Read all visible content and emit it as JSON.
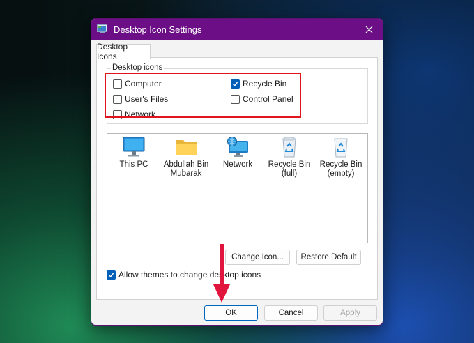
{
  "window": {
    "title": "Desktop Icon Settings",
    "accent_color": "#6c0e86"
  },
  "tabs": [
    {
      "label": "Desktop Icons",
      "active": true
    }
  ],
  "desktop_icons_group": {
    "legend": "Desktop icons",
    "items": [
      {
        "label": "Computer",
        "checked": false
      },
      {
        "label": "Recycle Bin",
        "checked": true
      },
      {
        "label": "User's Files",
        "checked": false
      },
      {
        "label": "Control Panel",
        "checked": false
      },
      {
        "label": "Network",
        "checked": false
      }
    ]
  },
  "icon_list": [
    {
      "label": "This PC",
      "icon": "monitor-icon"
    },
    {
      "label": "Abdullah Bin Mubarak",
      "icon": "folder-icon"
    },
    {
      "label": "Network",
      "icon": "network-icon"
    },
    {
      "label": "Recycle Bin (full)",
      "icon": "recycle-bin-full-icon"
    },
    {
      "label": "Recycle Bin (empty)",
      "icon": "recycle-bin-empty-icon"
    }
  ],
  "buttons": {
    "change_icon": "Change Icon...",
    "restore_default": "Restore Default",
    "ok": "OK",
    "cancel": "Cancel",
    "apply": "Apply"
  },
  "allow_themes": {
    "label": "Allow themes to change desktop icons",
    "checked": true
  },
  "annotations": {
    "highlight_color": "#e0141d"
  }
}
